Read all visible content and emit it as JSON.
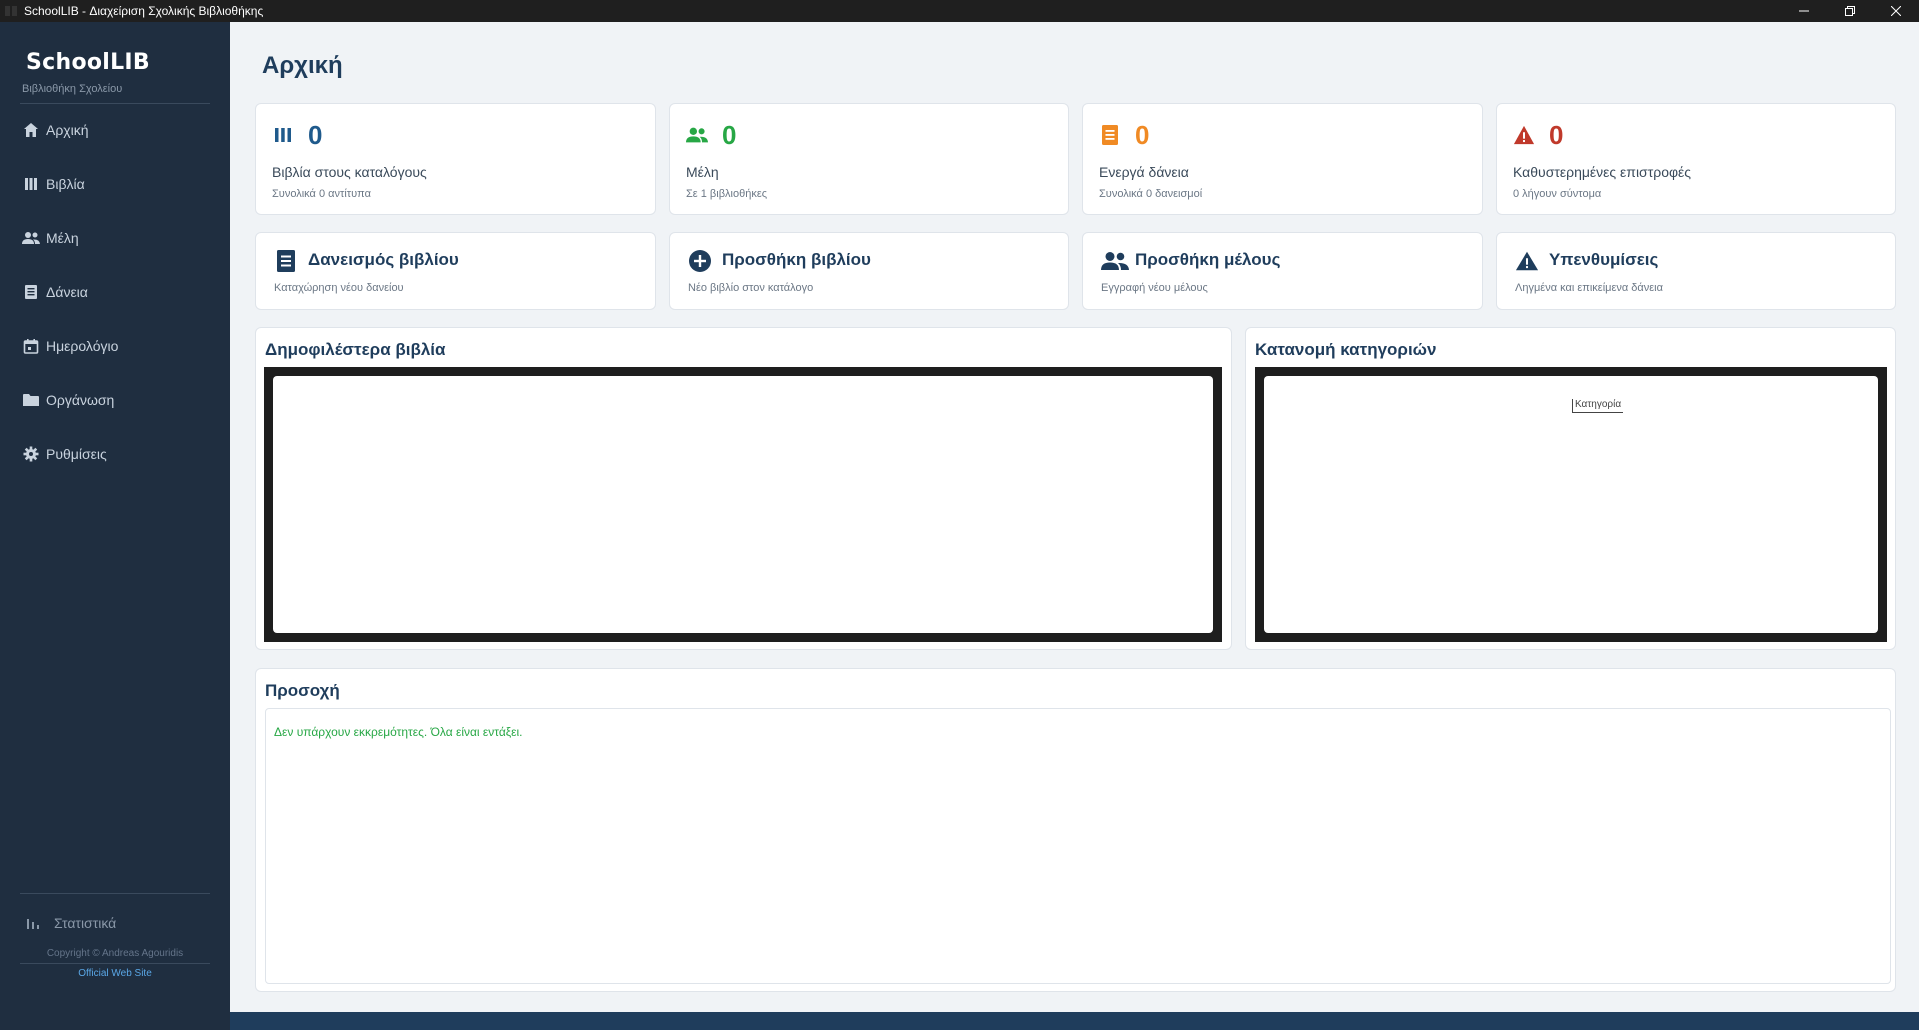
{
  "window": {
    "title": "SchoolLIB - Διαχείριση Σχολικής Βιβλιοθήκης"
  },
  "sidebar": {
    "brand": "SchoolLIB",
    "subtitle": "Βιβλιοθήκη Σχολείου",
    "items": [
      {
        "label": "Αρχική",
        "icon": "home-icon"
      },
      {
        "label": "Βιβλία",
        "icon": "books-icon"
      },
      {
        "label": "Μέλη",
        "icon": "members-icon"
      },
      {
        "label": "Δάνεια",
        "icon": "loans-icon"
      },
      {
        "label": "Ημερολόγιο",
        "icon": "calendar-icon"
      },
      {
        "label": "Οργάνωση",
        "icon": "folder-icon"
      },
      {
        "label": "Ρυθμίσεις",
        "icon": "gear-icon"
      }
    ],
    "stats_item": {
      "label": "Στατιστικά",
      "icon": "bar-chart-icon"
    },
    "copyright": "Copyright © Andreas Agouridis",
    "website": "Official Web Site"
  },
  "main": {
    "title": "Αρχική",
    "stats": [
      {
        "value": "0",
        "label": "Βιβλία στους καταλόγους",
        "sub": "Συνολικά 0 αντίτυπα",
        "color": "#1f5a8c",
        "icon": "books-icon"
      },
      {
        "value": "0",
        "label": "Μέλη",
        "sub": "Σε 1 βιβλιοθήκες",
        "color": "#27a745",
        "icon": "members-icon"
      },
      {
        "value": "0",
        "label": "Ενεργά δάνεια",
        "sub": "Συνολικά 0 δανεισμοί",
        "color": "#f08a24",
        "icon": "loans-icon"
      },
      {
        "value": "0",
        "label": "Καθυστερημένες επιστροφές",
        "sub": "0 λήγουν σύντομα",
        "color": "#c0392b",
        "icon": "warning-icon"
      }
    ],
    "quick_actions": [
      {
        "label": "Δανεισμός βιβλίου",
        "sub": "Καταχώρηση νέου δανείου",
        "icon": "loan-doc-icon"
      },
      {
        "label": "Προσθήκη βιβλίου",
        "sub": "Νέο βιβλίο στον κατάλογο",
        "icon": "plus-circle-icon"
      },
      {
        "label": "Προσθήκη μέλους",
        "sub": "Εγγραφή νέου μέλους",
        "icon": "members-icon"
      },
      {
        "label": "Υπενθυμίσεις",
        "sub": "Ληγμένα και επικείμενα δάνεια",
        "icon": "warning-icon"
      }
    ],
    "panels": {
      "popular_title": "Δημοφιλέστερα βιβλία",
      "categories_title": "Κατανομή κατηγοριών",
      "categories_legend": "Κατηγορία"
    },
    "notice": {
      "title": "Προσοχή",
      "text": "Δεν υπάρχουν εκκρεμότητες. Όλα είναι εντάξει."
    }
  }
}
